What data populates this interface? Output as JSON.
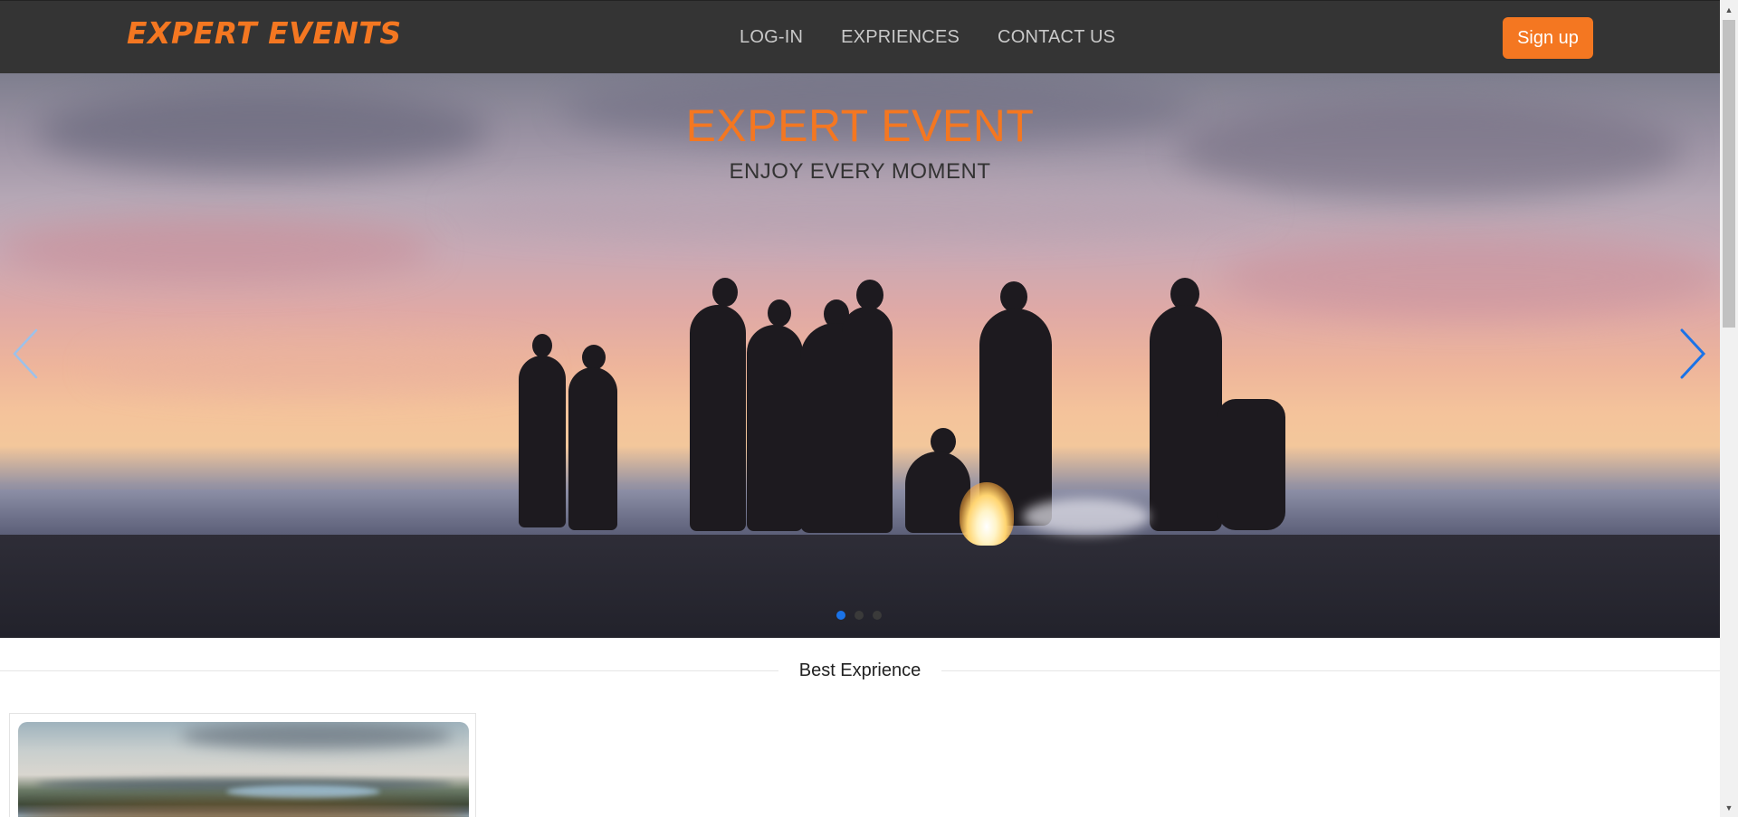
{
  "navbar": {
    "brand": "EXPERT EVENTS",
    "links": [
      "LOG-IN",
      "EXPRIENCES",
      "CONTACT US"
    ],
    "signup_label": "Sign up"
  },
  "hero": {
    "title": "EXPERT EVENT",
    "subtitle": "ENJOY EVERY MOMENT",
    "slide_count": 3,
    "active_slide": 1,
    "prev_icon": "chevron-left-icon",
    "next_icon": "chevron-right-icon"
  },
  "section": {
    "title": "Best Exprience"
  },
  "colors": {
    "accent": "#f47721",
    "navbar": "#343434",
    "indicator_active": "#1a73e8",
    "control_arrow": "#1a73e8"
  }
}
